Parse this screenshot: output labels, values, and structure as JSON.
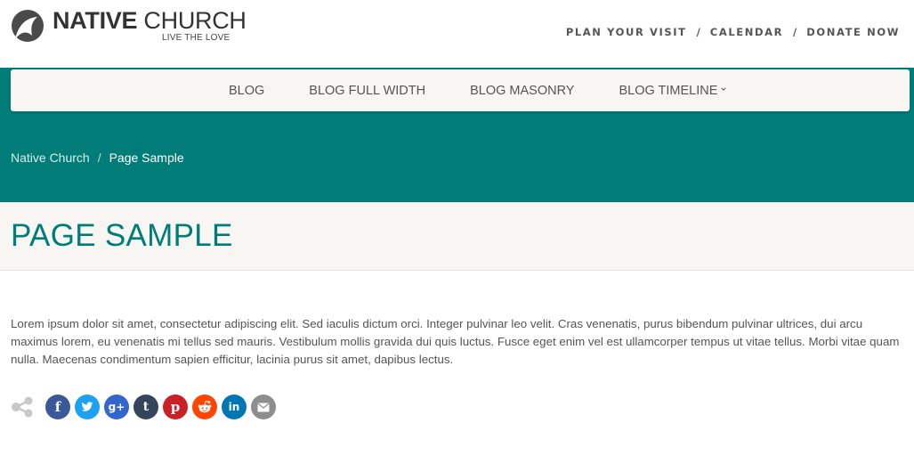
{
  "header": {
    "logo_name_bold": "NATIVE",
    "logo_name_light": " CHURCH",
    "tagline": "LIVE THE LOVE",
    "top_links": [
      "PLAN YOUR VISIT",
      "CALENDAR",
      "DONATE NOW"
    ],
    "separator": "/"
  },
  "nav": {
    "items": [
      "BLOG",
      "BLOG FULL WIDTH",
      "BLOG MASONRY",
      "BLOG TIMELINE"
    ]
  },
  "breadcrumb": {
    "home": "Native Church",
    "separator": "/",
    "current": "Page Sample"
  },
  "page": {
    "title": "PAGE SAMPLE",
    "body": "Lorem ipsum dolor sit amet, consectetur adipiscing elit. Sed iaculis dictum orci. Integer pulvinar leo velit. Cras venenatis, purus bibendum pulvinar ultrices, dui arcu maximus lorem, eu venenatis mi tellus sed mauris. Vestibulum mollis gravida dui quis luctus. Fusce eget enim vel est ullamcorper tempus ut vitae tellus. Morbi vitae quam nulla. Maecenas condimentum sapien efficitur, lacinia purus sit amet, dapibus lectus."
  },
  "share": {
    "buttons": [
      {
        "icon": "facebook-icon",
        "glyph": "f",
        "color": "#3b5998"
      },
      {
        "icon": "twitter-icon",
        "glyph": "",
        "color": "#1da1f2"
      },
      {
        "icon": "google-plus-icon",
        "glyph": "g+",
        "color": "#3366cc"
      },
      {
        "icon": "tumblr-icon",
        "glyph": "t",
        "color": "#35465c"
      },
      {
        "icon": "pinterest-icon",
        "glyph": "p",
        "color": "#cb2027"
      },
      {
        "icon": "reddit-icon",
        "glyph": "",
        "color": "#ff4500"
      },
      {
        "icon": "linkedin-icon",
        "glyph": "in",
        "color": "#0077b5"
      },
      {
        "icon": "email-icon",
        "glyph": "",
        "color": "#8e8e8e"
      }
    ]
  },
  "colors": {
    "brand_teal": "#007c79",
    "band_light": "#f7f6f2",
    "text": "#555555"
  }
}
